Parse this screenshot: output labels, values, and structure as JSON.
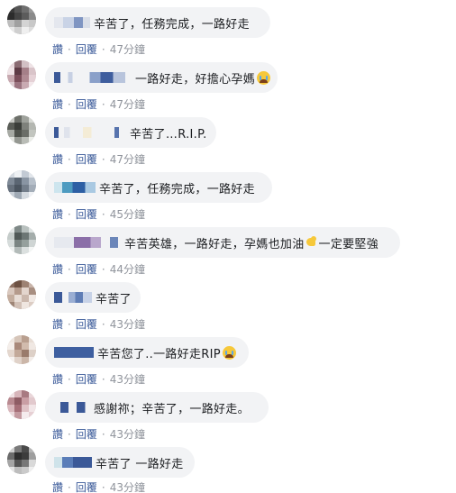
{
  "comments": [
    {
      "text": "辛苦了，任務完成，一路好走",
      "like_label": "讚",
      "reply_label": "回覆",
      "time": "47分鐘",
      "has_emoji": false,
      "has_muscle": false
    },
    {
      "text": "一路好走，好擔心孕媽",
      "like_label": "讚",
      "reply_label": "回覆",
      "time": "47分鐘",
      "has_emoji": true,
      "emoji_icon": "crying-face-icon",
      "has_muscle": false
    },
    {
      "text": "辛苦了…R.I.P.",
      "like_label": "讚",
      "reply_label": "回覆",
      "time": "47分鐘",
      "has_emoji": false,
      "has_muscle": false
    },
    {
      "text": "辛苦了，任務完成，一路好走",
      "like_label": "讚",
      "reply_label": "回覆",
      "time": "45分鐘",
      "has_emoji": false,
      "has_muscle": false
    },
    {
      "text": "辛苦英雄，一路好走，孕媽也加油",
      "text_after": "一定要堅強",
      "like_label": "讚",
      "reply_label": "回覆",
      "time": "44分鐘",
      "has_emoji": false,
      "has_muscle": true,
      "muscle_icon": "flexed-biceps-icon"
    },
    {
      "text": "辛苦了",
      "like_label": "讚",
      "reply_label": "回覆",
      "time": "43分鐘",
      "has_emoji": false,
      "has_muscle": false
    },
    {
      "text": "辛苦您了..一路好走RIP",
      "like_label": "讚",
      "reply_label": "回覆",
      "time": "43分鐘",
      "has_emoji": true,
      "emoji_icon": "crying-face-icon",
      "has_muscle": false
    },
    {
      "text": "感謝祢；辛苦了，一路好走。",
      "like_label": "讚",
      "reply_label": "回覆",
      "time": "43分鐘",
      "has_emoji": false,
      "has_muscle": false
    },
    {
      "text": "辛苦了 一路好走",
      "like_label": "讚",
      "reply_label": "回覆",
      "time": "43分鐘",
      "has_emoji": false,
      "has_muscle": false
    }
  ],
  "separator": "·",
  "colors": {
    "bubble_bg": "#f2f3f5",
    "text": "#1c1e21",
    "action_link": "#385898",
    "timestamp": "#90949c"
  }
}
